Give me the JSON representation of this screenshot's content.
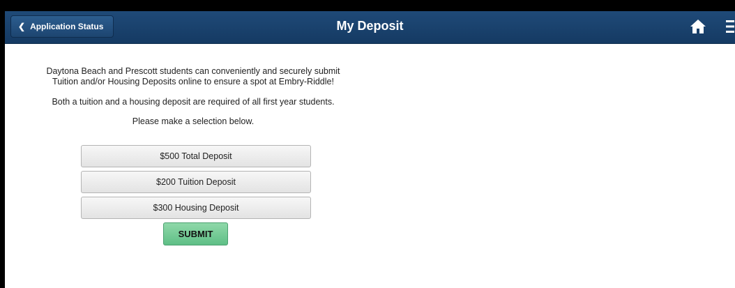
{
  "header": {
    "back_label": "Application Status",
    "title": "My Deposit",
    "back_icon": "chevron-left-icon",
    "home_icon": "home-icon",
    "menu_icon": "hamburger-menu-icon",
    "background_color": "#1f4a78"
  },
  "content": {
    "intro_line1": "Daytona Beach and Prescott students can conveniently and securely submit",
    "intro_line2": "Tuition and/or Housing Deposits online to ensure a spot at Embry-Riddle!",
    "note": "Both a tuition and a housing deposit are required of all first year students.",
    "prompt": "Please make a selection below."
  },
  "options": [
    {
      "label": "$500 Total Deposit"
    },
    {
      "label": "$200 Tuition Deposit"
    },
    {
      "label": "$300 Housing Deposit"
    }
  ],
  "submit_label": "SUBMIT",
  "colors": {
    "submit_green": "#6cc892",
    "header_blue": "#1f4a78"
  }
}
